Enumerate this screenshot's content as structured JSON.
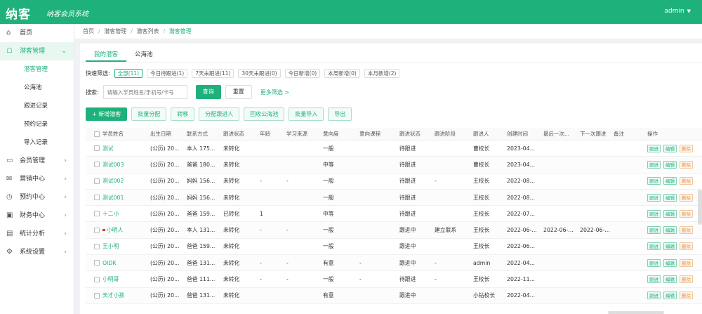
{
  "header": {
    "logo": "纳客",
    "slogan": "纳客会员系统",
    "user": "admin"
  },
  "sidebar": {
    "items": [
      {
        "label": "首页",
        "icon": "home-icon",
        "arrow": ""
      },
      {
        "label": "潜客管理",
        "icon": "user-icon",
        "arrow": "⌄"
      },
      {
        "label": "会员管理",
        "icon": "card-icon",
        "arrow": "›"
      },
      {
        "label": "营销中心",
        "icon": "gift-icon",
        "arrow": "›"
      },
      {
        "label": "预约中心",
        "icon": "clock-icon",
        "arrow": "›"
      },
      {
        "label": "财务中心",
        "icon": "wallet-icon",
        "arrow": "›"
      },
      {
        "label": "统计分析",
        "icon": "chart-icon",
        "arrow": "›"
      },
      {
        "label": "系统设置",
        "icon": "gear-icon",
        "arrow": "›"
      }
    ],
    "sub_items": [
      "潜客管理",
      "公海池",
      "跟进记录",
      "预约记录",
      "导入记录"
    ]
  },
  "breadcrumb": [
    "首页",
    "潜客管理",
    "潜客列表",
    "潜客管理"
  ],
  "tabs": [
    "我的潜客",
    "公海池"
  ],
  "quick_filter": {
    "label": "快速筛选:",
    "chips": [
      "全部(11)",
      "今日待跟进(1)",
      "7天未跟进(11)",
      "30天未跟进(0)",
      "今日新增(0)",
      "本周新增(0)",
      "本月新增(2)"
    ]
  },
  "search": {
    "label": "搜索:",
    "placeholder": "请输入学员姓名/手机号/卡号",
    "query_label": "查询",
    "reset_label": "重置",
    "advanced_label": "更多筛选 >"
  },
  "toolbar": [
    "+ 新增潜客",
    "批量分配",
    "转移",
    "分配跟进人",
    "回收公海池",
    "批量导入",
    "导出"
  ],
  "table": {
    "headers": [
      "学员姓名",
      "出生日期",
      "联系方式",
      "跟进状态",
      "年龄",
      "学习来源",
      "意向度",
      "意向课程",
      "跟进状态",
      "跟进阶段",
      "跟进人",
      "创建时间",
      "最后一次...",
      "下一次跟进",
      "备注",
      "操作"
    ],
    "rows": [
      [
        "测试",
        "(公历) 20...",
        "本人 175...",
        "未转化",
        "",
        "",
        "一般",
        "",
        "待跟进",
        "",
        "曹校长",
        "2023-04...",
        "",
        "",
        ""
      ],
      [
        "测试003",
        "(公历) 20...",
        "爸爸 180...",
        "未转化",
        "",
        "",
        "中等",
        "",
        "待跟进",
        "",
        "曹校长",
        "2023-04...",
        "",
        "",
        ""
      ],
      [
        "测试002",
        "(公历) 20...",
        "妈妈 156...",
        "未转化",
        "-",
        "-",
        "一般",
        "",
        "待跟进",
        "-",
        "王校长",
        "2022-08...",
        "",
        "",
        ""
      ],
      [
        "测试001",
        "(公历) 20...",
        "妈妈 156...",
        "未转化",
        "",
        "",
        "一般",
        "",
        "待跟进",
        "",
        "王校长",
        "2022-08...",
        "",
        "",
        ""
      ],
      [
        "十二小",
        "(公历) 20...",
        "爸爸 159...",
        "已转化",
        "1",
        "",
        "中等",
        "",
        "待跟进",
        "",
        "王校长",
        "2022-07...",
        "",
        "",
        ""
      ],
      [
        "小明人",
        "(公历) 20...",
        "本人 131...",
        "未转化",
        "-",
        "-",
        "一般",
        "",
        "跟进中",
        "建立联系",
        "王校长",
        "2022-06-...",
        "2022-06-...",
        "2022-06-...",
        ""
      ],
      [
        "王小明",
        "(公历) 20...",
        "爸爸 159...",
        "未转化",
        "",
        "",
        "一般",
        "",
        "跟进中",
        "",
        "王校长",
        "2022-06...",
        "",
        "",
        ""
      ],
      [
        "OIDK",
        "(公历) 20...",
        "爸爸 131...",
        "未转化",
        "-",
        "-",
        "有意",
        "-",
        "跟进中",
        "-",
        "admin",
        "2022-04...",
        "",
        "",
        ""
      ],
      [
        "小明哥",
        "(公历) 20...",
        "爸爸 111...",
        "未转化",
        "-",
        "-",
        "一般",
        "-",
        "待跟进",
        "-",
        "王校长",
        "2022-11...",
        "",
        "",
        ""
      ],
      [
        "天才小孩",
        "(公历) 20...",
        "爸爸 131...",
        "未转化",
        "",
        "",
        "有意",
        "",
        "跟进中",
        "",
        "小钻校长",
        "2022-04...",
        "",
        "",
        ""
      ]
    ],
    "ops": [
      "跟进",
      "编辑",
      "删除"
    ]
  },
  "colors": {
    "brand": "#1fb17b",
    "warn": "#e8964a",
    "tag": "#e0323a"
  }
}
